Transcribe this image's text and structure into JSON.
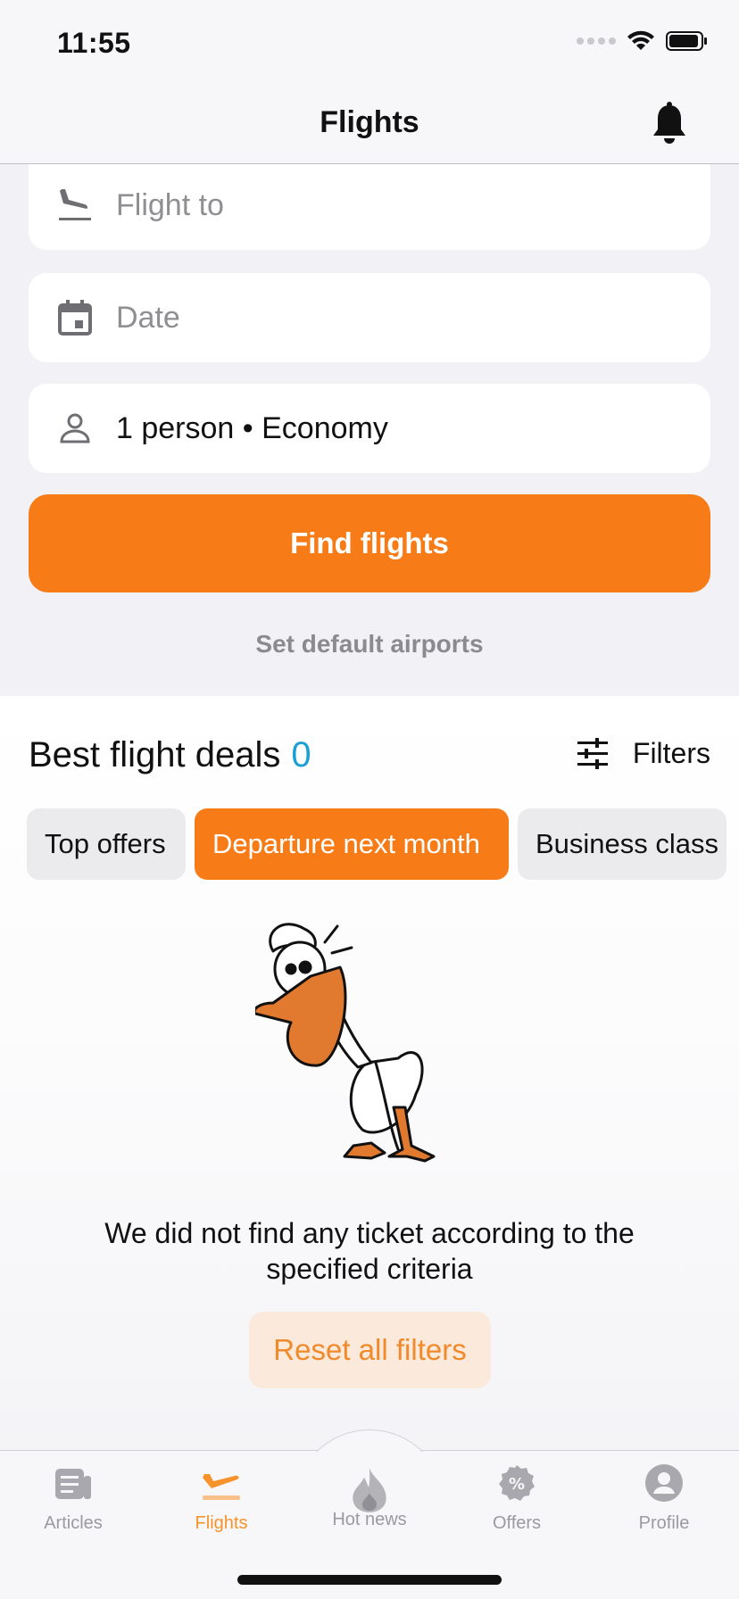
{
  "status_bar": {
    "time": "11:55"
  },
  "header": {
    "title": "Flights"
  },
  "search": {
    "flight_to_placeholder": "Flight to",
    "date_placeholder": "Date",
    "passengers_value": "1 person • Economy",
    "find_button": "Find flights",
    "default_airports_link": "Set default airports"
  },
  "deals": {
    "title": "Best flight deals",
    "count": "0",
    "filters_label": "Filters",
    "chips": [
      {
        "label": "Top offers",
        "active": false
      },
      {
        "label": "Departure next month",
        "active": true
      },
      {
        "label": "Business class",
        "active": false
      }
    ],
    "empty_message": "We did not find any ticket according to the specified criteria",
    "reset_button": "Reset all filters"
  },
  "tabbar": {
    "items": [
      {
        "label": "Articles",
        "icon": "articles-icon",
        "active": false
      },
      {
        "label": "Flights",
        "icon": "plane-icon",
        "active": true
      },
      {
        "label": "Hot news",
        "icon": "flame-icon",
        "active": false
      },
      {
        "label": "Offers",
        "icon": "percent-badge-icon",
        "active": false
      },
      {
        "label": "Profile",
        "icon": "profile-icon",
        "active": false
      }
    ]
  },
  "colors": {
    "accent": "#f77c17",
    "count": "#1a9fd6",
    "reset_bg": "#fbe9dc"
  }
}
